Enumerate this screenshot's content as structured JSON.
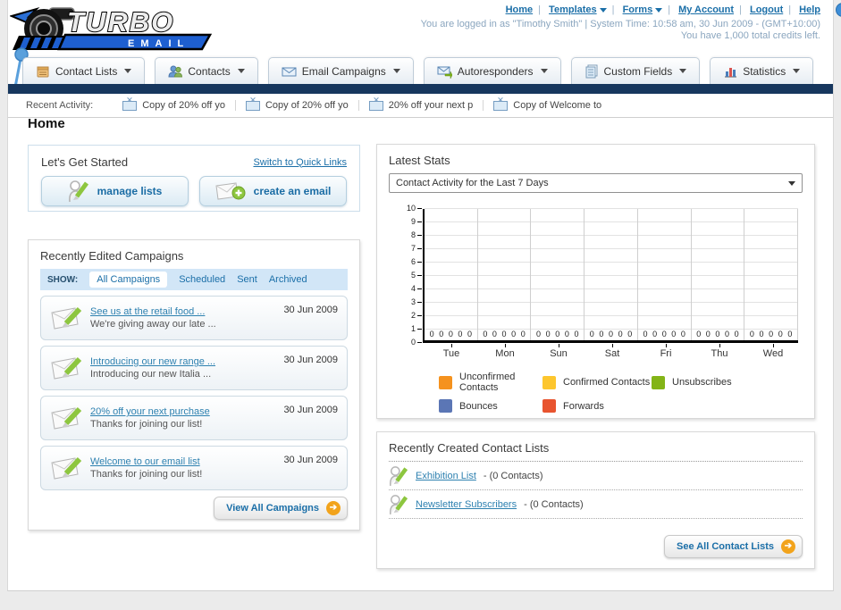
{
  "header": {
    "logo_title": "TURBO",
    "logo_subtitle": "EMAIL",
    "nav_links": [
      {
        "label": "Home",
        "dropdown": false
      },
      {
        "label": "Templates",
        "dropdown": true
      },
      {
        "label": "Forms",
        "dropdown": true
      },
      {
        "label": "My Account",
        "dropdown": false
      },
      {
        "label": "Logout",
        "dropdown": false
      },
      {
        "label": "Help",
        "dropdown": false
      }
    ],
    "status_line1": "You are logged in as \"Timothy Smith\" | System Time: 10:58 am, 30 Jun 2009 - (GMT+10:00)",
    "status_line2": "You have 1,000 total credits left."
  },
  "main_nav": {
    "tabs": [
      {
        "label": "Contact Lists",
        "icon": "contact-lists-icon"
      },
      {
        "label": "Contacts",
        "icon": "contacts-icon"
      },
      {
        "label": "Email Campaigns",
        "icon": "email-campaigns-icon"
      },
      {
        "label": "Autoresponders",
        "icon": "autoresponders-icon"
      },
      {
        "label": "Custom Fields",
        "icon": "custom-fields-icon"
      },
      {
        "label": "Statistics",
        "icon": "statistics-icon"
      }
    ]
  },
  "recent_activity": {
    "label": "Recent Activity:",
    "items": [
      "Copy of 20% off yo",
      "Copy of 20% off yo",
      "20% off your next p",
      "Copy of Welcome to"
    ]
  },
  "page": {
    "title": "Home"
  },
  "get_started": {
    "title": "Let's Get Started",
    "switch_link": "Switch to Quick Links",
    "buttons": [
      {
        "label": "manage lists",
        "icon": "person-pencil-icon"
      },
      {
        "label": "create an email",
        "icon": "envelope-plus-icon"
      }
    ]
  },
  "campaigns": {
    "title": "Recently Edited Campaigns",
    "filter_label": "SHOW:",
    "filters": [
      {
        "label": "All Campaigns",
        "active": true
      },
      {
        "label": "Scheduled",
        "active": false
      },
      {
        "label": "Sent",
        "active": false
      },
      {
        "label": "Archived",
        "active": false
      }
    ],
    "items": [
      {
        "title": "See us at the retail food ...",
        "subtitle": "We're giving away our late ...",
        "date": "30 Jun 2009"
      },
      {
        "title": "Introducing our new range ...",
        "subtitle": "Introducing our new Italia ...",
        "date": "30 Jun 2009"
      },
      {
        "title": "20% off your next purchase",
        "subtitle": "Thanks for joining our list!",
        "date": "30 Jun 2009"
      },
      {
        "title": "Welcome to our email list",
        "subtitle": "Thanks for joining our list!",
        "date": "30 Jun 2009"
      }
    ],
    "view_all_label": "View All Campaigns"
  },
  "stats": {
    "title": "Latest Stats",
    "selected_option": "Contact Activity for the Last 7 Days"
  },
  "chart_data": {
    "type": "bar",
    "title": "Contact Activity for the Last 7 Days",
    "categories": [
      "Tue",
      "Mon",
      "Sun",
      "Sat",
      "Fri",
      "Thu",
      "Wed"
    ],
    "series": [
      {
        "name": "Unconfirmed Contacts",
        "color": "#f5921e",
        "values": [
          0,
          0,
          0,
          0,
          0,
          0,
          0
        ]
      },
      {
        "name": "Confirmed Contacts",
        "color": "#fdc62e",
        "values": [
          0,
          0,
          0,
          0,
          0,
          0,
          0
        ]
      },
      {
        "name": "Unsubscribes",
        "color": "#83b417",
        "values": [
          0,
          0,
          0,
          0,
          0,
          0,
          0
        ]
      },
      {
        "name": "Bounces",
        "color": "#5b76b5",
        "values": [
          0,
          0,
          0,
          0,
          0,
          0,
          0
        ]
      },
      {
        "name": "Forwards",
        "color": "#e8542f",
        "values": [
          0,
          0,
          0,
          0,
          0,
          0,
          0
        ]
      }
    ],
    "xlabel": "",
    "ylabel": "",
    "ylim": [
      0,
      10
    ],
    "yticks": [
      0,
      1,
      2,
      3,
      4,
      5,
      6,
      7,
      8,
      9,
      10
    ],
    "grid": true,
    "legend_position": "bottom",
    "value_labels_shown": true
  },
  "contact_lists": {
    "title": "Recently Created Contact Lists",
    "items": [
      {
        "name": "Exhibition List",
        "detail": "- (0 Contacts)"
      },
      {
        "name": "Newsletter Subscribers",
        "detail": "- (0 Contacts)"
      }
    ],
    "see_all_label": "See All Contact Lists"
  },
  "colors": {
    "navy_bar": "#17375e",
    "link_blue": "#1b6fa8",
    "accent_orange": "#f2a31b",
    "accent_green": "#8dc63f",
    "filter_bar_bg": "#d2e6f7"
  }
}
